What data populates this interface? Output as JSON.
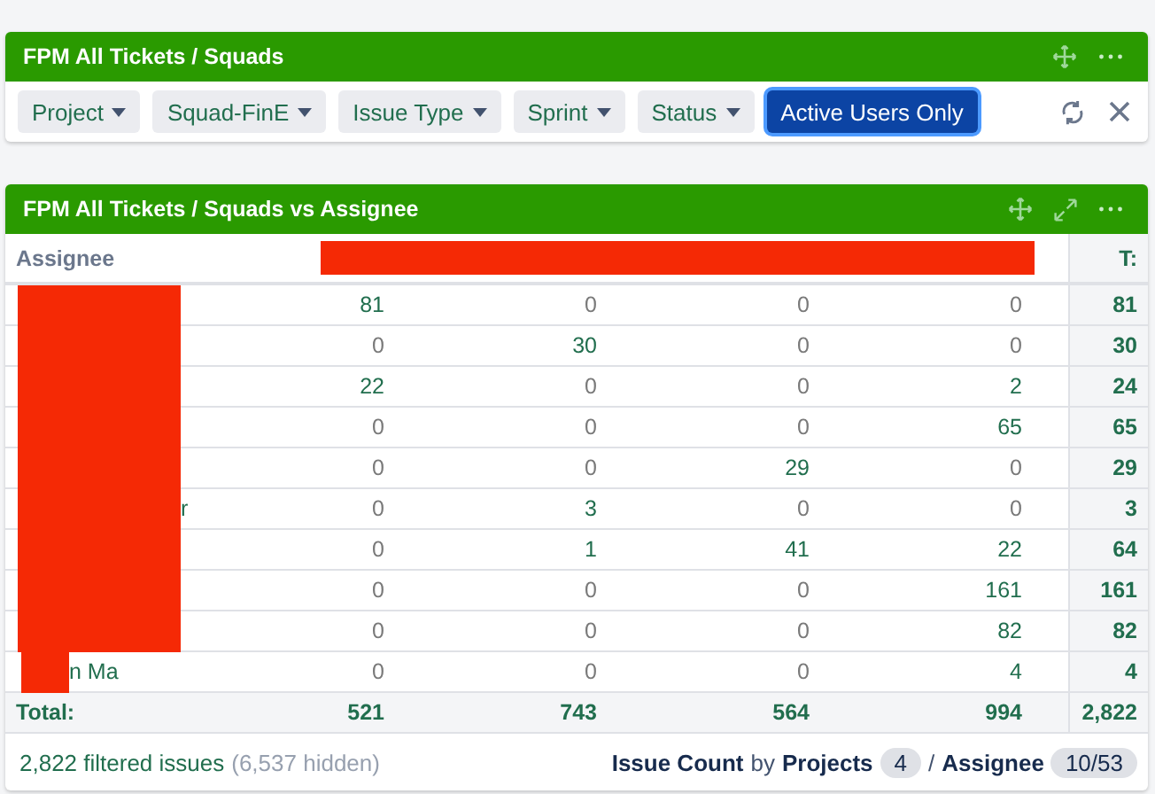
{
  "filter_panel": {
    "title": "FPM All Tickets / Squads",
    "filters": [
      {
        "label": "Project",
        "kind": "dropdown",
        "selected": false
      },
      {
        "label": "Squad-FinE",
        "kind": "dropdown",
        "selected": false
      },
      {
        "label": "Issue Type",
        "kind": "dropdown",
        "selected": false
      },
      {
        "label": "Sprint",
        "kind": "dropdown",
        "selected": false
      },
      {
        "label": "Status",
        "kind": "dropdown",
        "selected": false
      },
      {
        "label": "Active Users Only",
        "kind": "toggle",
        "selected": true
      }
    ]
  },
  "table_panel": {
    "title": "FPM All Tickets / Squads vs Assignee",
    "header": {
      "first": "Assignee",
      "redacted": true,
      "last": "T:"
    },
    "rows": [
      {
        "redacted": true,
        "redaction_wide": true,
        "values": [
          "81",
          "0",
          "0",
          "0"
        ],
        "total": "81"
      },
      {
        "redacted": true,
        "redaction_wide": true,
        "values": [
          "0",
          "30",
          "0",
          "0"
        ],
        "total": "30"
      },
      {
        "redacted": true,
        "redaction_wide": true,
        "values": [
          "22",
          "0",
          "0",
          "2"
        ],
        "total": "24"
      },
      {
        "redacted": true,
        "redaction_wide": true,
        "values": [
          "0",
          "0",
          "0",
          "65"
        ],
        "total": "65"
      },
      {
        "redacted": true,
        "redaction_wide": true,
        "values": [
          "0",
          "0",
          "29",
          "0"
        ],
        "total": "29"
      },
      {
        "redacted": true,
        "redaction_wide": true,
        "assignee": "r",
        "values": [
          "0",
          "3",
          "0",
          "0"
        ],
        "total": "3"
      },
      {
        "redacted": true,
        "redaction_wide": true,
        "values": [
          "0",
          "1",
          "41",
          "22"
        ],
        "total": "64"
      },
      {
        "redacted": true,
        "redaction_wide": true,
        "values": [
          "0",
          "0",
          "0",
          "161"
        ],
        "total": "161"
      },
      {
        "redacted": true,
        "redaction_wide": true,
        "values": [
          "0",
          "0",
          "0",
          "82"
        ],
        "total": "82"
      },
      {
        "redacted": true,
        "redaction_wide": false,
        "assignee": "n Ma",
        "values": [
          "0",
          "0",
          "0",
          "4"
        ],
        "total": "4"
      }
    ],
    "totals": {
      "label": "Total:",
      "values": [
        "521",
        "743",
        "564",
        "994"
      ],
      "total": "2,822"
    },
    "footer": {
      "filtered": "2,822 filtered issues",
      "hidden": "(6,537 hidden)",
      "measure": "Issue Count",
      "by": "by",
      "dim1": "Projects",
      "dim1_count": "4",
      "sep": "/",
      "dim2": "Assignee",
      "dim2_count": "10/53"
    }
  }
}
